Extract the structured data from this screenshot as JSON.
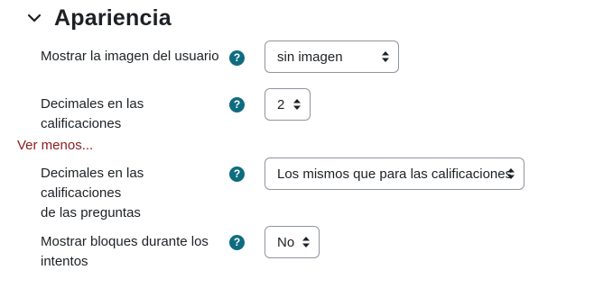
{
  "section": {
    "title": "Apariencia"
  },
  "fields": {
    "show_user_picture": {
      "label": "Mostrar la imagen del usuario",
      "value": "sin imagen"
    },
    "grade_decimals": {
      "label": "Decimales en las calificaciones",
      "value": "2"
    },
    "show_less_link": "Ver menos...",
    "question_grade_decimals": {
      "label_line1": "Decimales en las calificaciones",
      "label_line2": "de las preguntas",
      "value": "Los mismos que para las calificaciones"
    },
    "show_blocks": {
      "label_line1": "Mostrar bloques durante los",
      "label_line2": "intentos",
      "value": "No"
    }
  },
  "help_icon_text": "?",
  "colors": {
    "help_icon": "#0f6c80",
    "link": "#8b1a1a",
    "border": "#8f959e"
  }
}
